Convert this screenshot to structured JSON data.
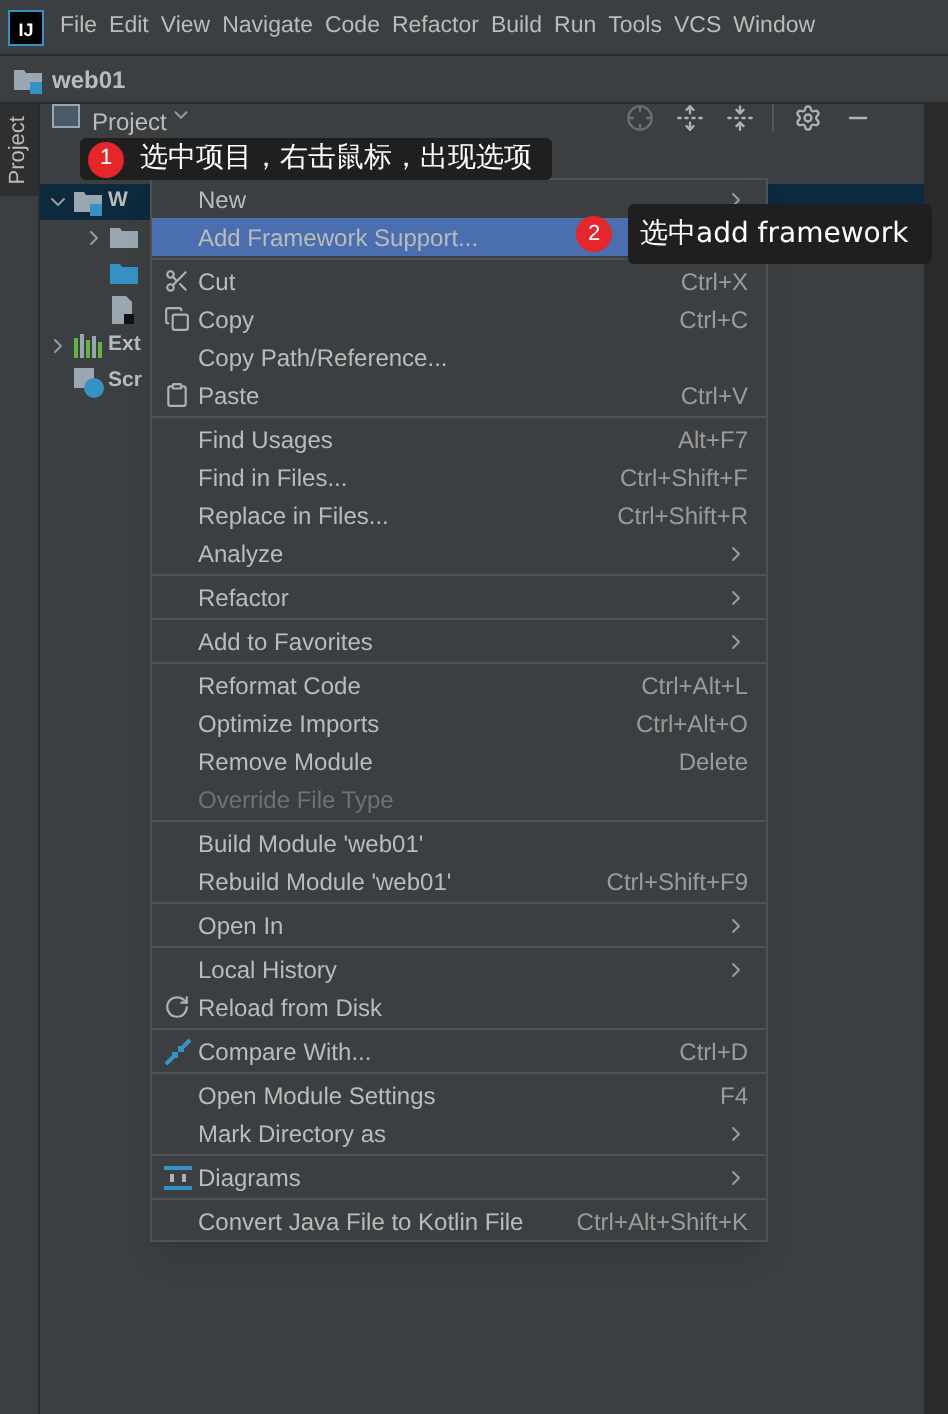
{
  "logo": "IJ",
  "menu_bar": [
    "File",
    "Edit",
    "View",
    "Navigate",
    "Code",
    "Refactor",
    "Build",
    "Run",
    "Tools",
    "VCS",
    "Window"
  ],
  "navigation": {
    "project": "web01"
  },
  "tool_window_tab": {
    "label": "Project",
    "selected": true
  },
  "project_panel": {
    "view_selector": "Project"
  },
  "tree": [
    {
      "label": "W",
      "kind": "module",
      "selected": true,
      "expanded": true,
      "children": [
        {
          "kind": "folder",
          "expanded": false
        },
        {
          "kind": "source-folder"
        },
        {
          "kind": "file"
        }
      ]
    },
    {
      "label": "Ext",
      "kind": "libraries",
      "selected": false,
      "expanded": false
    },
    {
      "label": "Scr",
      "kind": "scratches",
      "selected": false
    }
  ],
  "menu": {
    "groups": [
      [
        {
          "label": "New",
          "submenu": true,
          "selected": false
        },
        {
          "label": "Add Framework Support...",
          "selected": true
        }
      ],
      [
        {
          "label": "Cut",
          "shortcut": "Ctrl+X",
          "kind": "scissors",
          "selected": false
        },
        {
          "label": "Copy",
          "shortcut": "Ctrl+C",
          "kind": "copy",
          "selected": false
        },
        {
          "label": "Copy Path/Reference...",
          "selected": false
        },
        {
          "label": "Paste",
          "shortcut": "Ctrl+V",
          "kind": "paste",
          "selected": false
        }
      ],
      [
        {
          "label": "Find Usages",
          "shortcut": "Alt+F7",
          "selected": false
        },
        {
          "label": "Find in Files...",
          "shortcut": "Ctrl+Shift+F",
          "selected": false
        },
        {
          "label": "Replace in Files...",
          "shortcut": "Ctrl+Shift+R",
          "selected": false
        },
        {
          "label": "Analyze",
          "submenu": true,
          "selected": false
        }
      ],
      [
        {
          "label": "Refactor",
          "submenu": true,
          "selected": false
        }
      ],
      [
        {
          "label": "Add to Favorites",
          "submenu": true,
          "selected": false
        }
      ],
      [
        {
          "label": "Reformat Code",
          "shortcut": "Ctrl+Alt+L",
          "selected": false
        },
        {
          "label": "Optimize Imports",
          "shortcut": "Ctrl+Alt+O",
          "selected": false
        },
        {
          "label": "Remove Module",
          "shortcut": "Delete",
          "selected": false
        },
        {
          "label": "Override File Type",
          "disabled": true,
          "selected": false
        }
      ],
      [
        {
          "label": "Build Module 'web01'",
          "selected": false
        },
        {
          "label": "Rebuild Module 'web01'",
          "shortcut": "Ctrl+Shift+F9",
          "selected": false
        }
      ],
      [
        {
          "label": "Open In",
          "submenu": true,
          "selected": false
        }
      ],
      [
        {
          "label": "Local History",
          "submenu": true,
          "selected": false
        },
        {
          "label": "Reload from Disk",
          "kind": "reload",
          "selected": false
        }
      ],
      [
        {
          "label": "Compare With...",
          "shortcut": "Ctrl+D",
          "kind": "compare",
          "selected": false
        }
      ],
      [
        {
          "label": "Open Module Settings",
          "shortcut": "F4",
          "selected": false
        },
        {
          "label": "Mark Directory as",
          "submenu": true,
          "selected": false
        }
      ],
      [
        {
          "label": "Diagrams",
          "submenu": true,
          "kind": "diagrams",
          "selected": false
        }
      ],
      [
        {
          "label": "Convert Java File to Kotlin File",
          "shortcut": "Ctrl+Alt+Shift+K",
          "selected": false
        }
      ]
    ]
  },
  "annotations": [
    {
      "number": "1",
      "text": "选中项目，右击鼠标，出现选项"
    },
    {
      "number": "2",
      "text": "选中add framework"
    }
  ]
}
